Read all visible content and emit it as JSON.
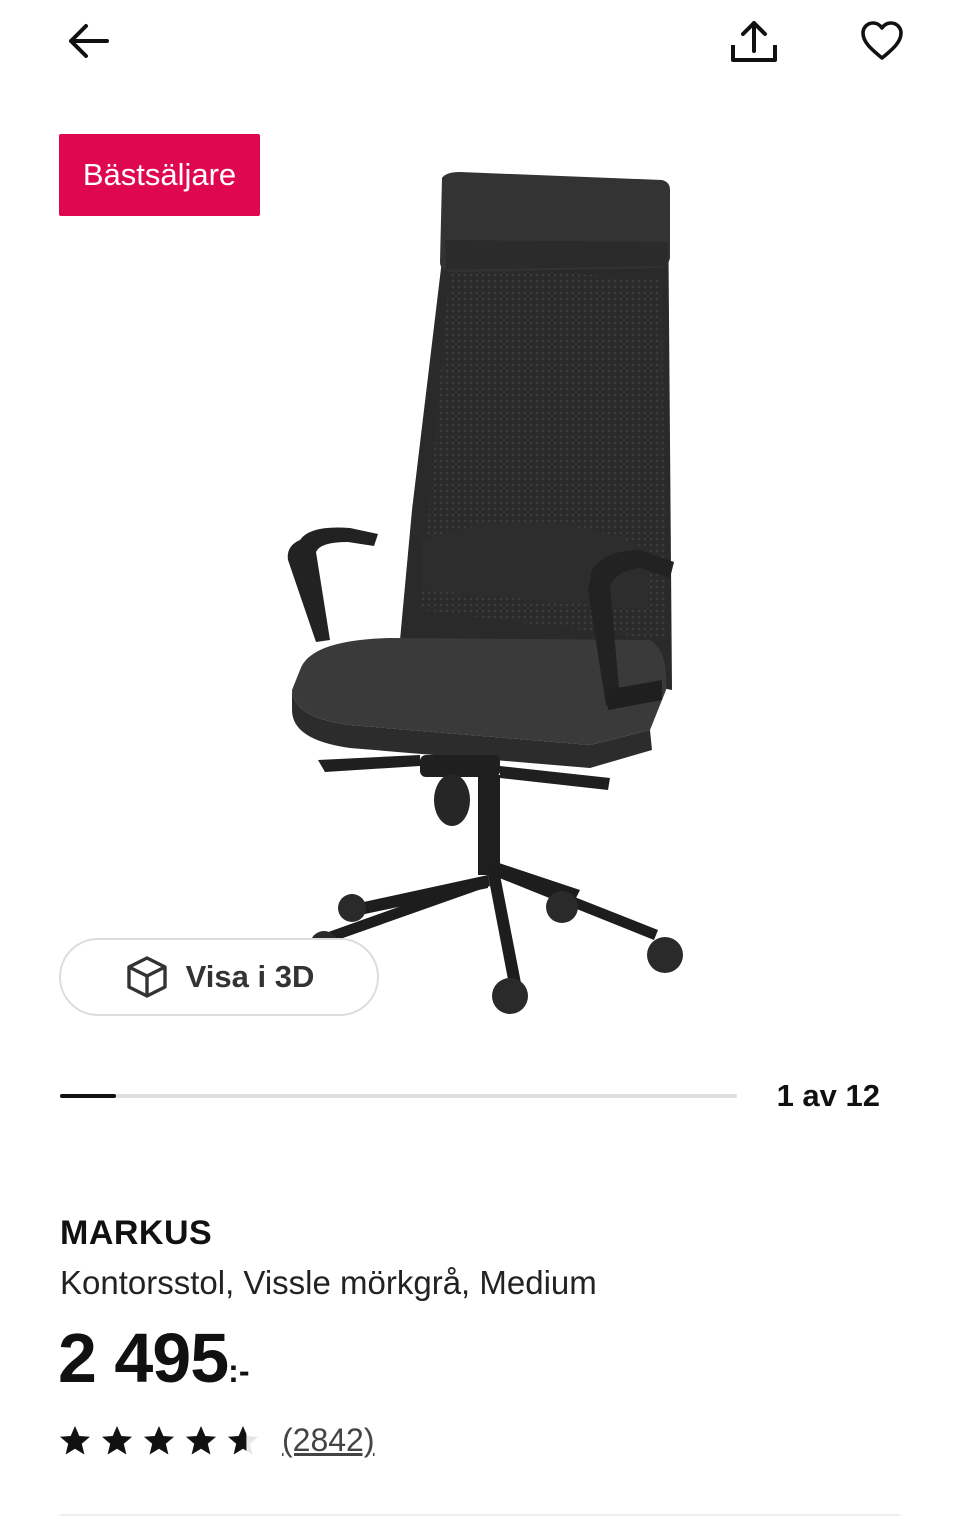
{
  "topbar": {
    "back_icon": "arrow-left-icon",
    "share_icon": "share-upload-icon",
    "favorite_icon": "heart-outline-icon"
  },
  "badge": {
    "label": "Bästsäljare",
    "color": "#e00751"
  },
  "gallery": {
    "image_subject": "office-chair",
    "view3d_label": "Visa i 3D",
    "view3d_icon": "cube-icon",
    "current": 1,
    "total": 12,
    "progress": 0.083,
    "counter_text": "1 av 12"
  },
  "product": {
    "name": "MARKUS",
    "description": "Kontorsstol, Vissle mörkgrå, Medium",
    "price": "2 495",
    "price_suffix": ":-",
    "rating": 4.6,
    "rating_max": 5,
    "review_count_text": "(2842)"
  }
}
